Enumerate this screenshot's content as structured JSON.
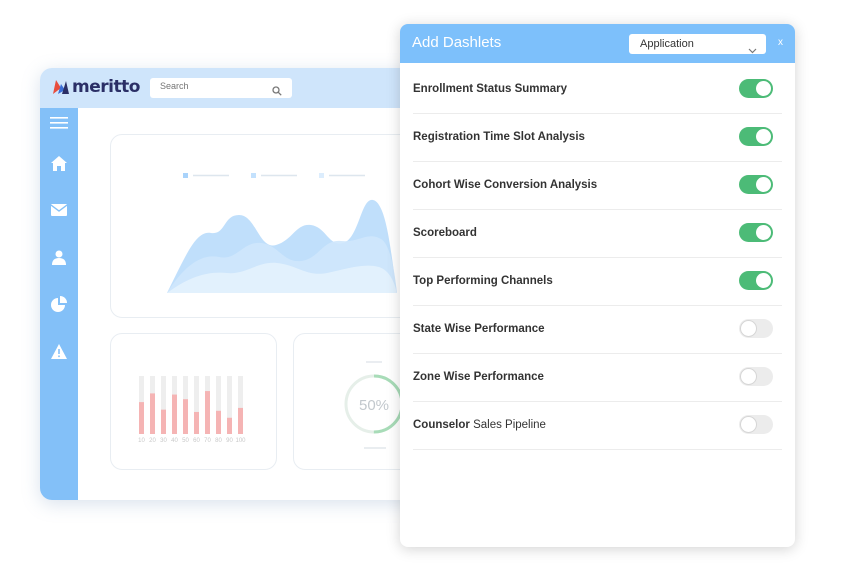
{
  "app": {
    "brand": "meritto",
    "search_placeholder": "Search",
    "sidebar_icons": [
      "menu-icon",
      "home-icon",
      "mail-icon",
      "user-icon",
      "pie-chart-icon",
      "alert-icon"
    ],
    "accent_color": "#83c0f8"
  },
  "progress_card": {
    "percent_label": "50%",
    "value": 0.5
  },
  "bar_card": {
    "tick_labels": [
      "10",
      "20",
      "30",
      "40",
      "50",
      "60",
      "70",
      "80",
      "90",
      "100"
    ],
    "values": [
      0.55,
      0.7,
      0.42,
      0.68,
      0.6,
      0.38,
      0.74,
      0.4,
      0.28,
      0.45
    ]
  },
  "panel": {
    "title": "Add Dashlets",
    "select_value": "Application",
    "close_label": "x",
    "items": [
      {
        "label": "Enrollment Status Summary",
        "enabled": true
      },
      {
        "label": "Registration Time Slot Analysis",
        "enabled": true
      },
      {
        "label": "Cohort Wise Conversion Analysis",
        "enabled": true
      },
      {
        "label": "Scoreboard",
        "enabled": true
      },
      {
        "label": "Top Performing Channels",
        "enabled": true
      },
      {
        "label": "State Wise Performance",
        "enabled": false
      },
      {
        "label": "Zone Wise Performance",
        "enabled": false
      },
      {
        "label": "Counselor",
        "label_suffix": " Sales Pipeline",
        "enabled": false
      }
    ]
  }
}
